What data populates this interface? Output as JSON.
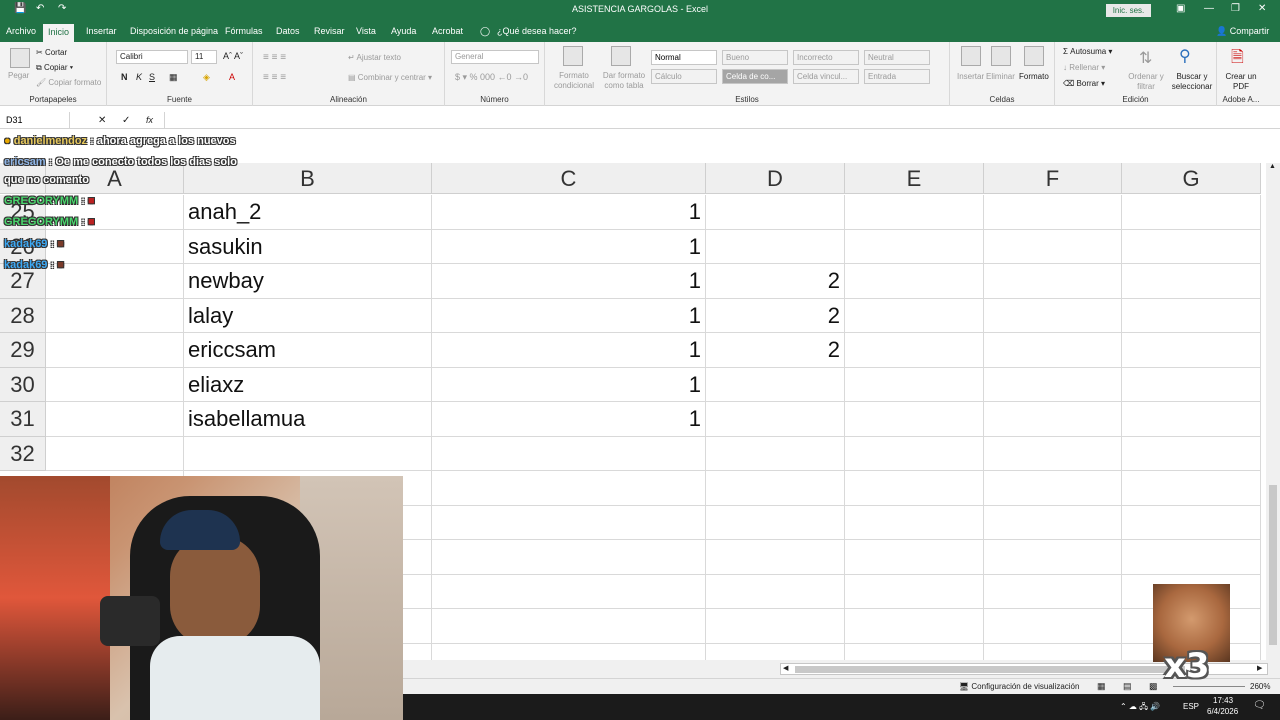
{
  "window": {
    "title": "ASISTENCIA GARGOLAS  -  Excel",
    "signin": "Inic. ses."
  },
  "tabs": [
    "Archivo",
    "Inicio",
    "Insertar",
    "Disposición de página",
    "Fórmulas",
    "Datos",
    "Revisar",
    "Vista",
    "Ayuda",
    "Acrobat"
  ],
  "tell_me": "¿Qué desea hacer?",
  "share": "Compartir",
  "ribbon": {
    "clipboard": {
      "paste": "Pegar",
      "cut": "Cortar",
      "copy": "Copiar",
      "format_painter": "Copiar formato",
      "label": "Portapapeles"
    },
    "font": {
      "name": "Calibri",
      "size": "11",
      "label": "Fuente"
    },
    "alignment": {
      "wrap": "Ajustar texto",
      "merge": "Combinar y centrar",
      "label": "Alineación"
    },
    "number": {
      "format": "General",
      "label": "Número"
    },
    "styles": {
      "conditional": "Formato condicional",
      "as_table": "Dar formato como tabla",
      "cells": [
        "Normal",
        "Bueno",
        "Incorrecto",
        "Neutral",
        "Cálculo",
        "Celda de co...",
        "Celda vincul...",
        "Entrada"
      ],
      "label": "Estilos"
    },
    "cells_group": {
      "insert": "Insertar",
      "delete": "Eliminar",
      "format": "Formato",
      "label": "Celdas"
    },
    "editing": {
      "autosum": "Autosuma",
      "fill": "Rellenar",
      "clear": "Borrar",
      "sort": "Ordenar y filtrar",
      "find": "Buscar y seleccionar",
      "label": "Edición"
    },
    "adobe": {
      "create_pdf": "Crear un PDF",
      "label": "Adobe A..."
    }
  },
  "formula_bar": {
    "name_box": "D31",
    "fx": "fx"
  },
  "sheet": {
    "columns": [
      "A",
      "B",
      "C",
      "D",
      "E",
      "F",
      "G"
    ],
    "rows": [
      {
        "n": "25",
        "b": "anah_2",
        "c": "1",
        "d": ""
      },
      {
        "n": "26",
        "b": "sasukin",
        "c": "1",
        "d": ""
      },
      {
        "n": "27",
        "b": "newbay",
        "c": "1",
        "d": "2"
      },
      {
        "n": "28",
        "b": "lalay",
        "c": "1",
        "d": "2"
      },
      {
        "n": "29",
        "b": "ericcsam",
        "c": "1",
        "d": "2"
      },
      {
        "n": "30",
        "b": "eliaxz",
        "c": "1",
        "d": ""
      },
      {
        "n": "31",
        "b": "isabellamua",
        "c": "1",
        "d": ""
      },
      {
        "n": "32",
        "b": "",
        "c": "",
        "d": ""
      }
    ]
  },
  "status": {
    "display_settings": "Configuración de visualización",
    "zoom": "260%"
  },
  "taskbar": {
    "lang": "ESP",
    "time": "17:43",
    "date": "6/4/2026"
  },
  "chat": [
    {
      "user": "danielmendoz",
      "text": ": ahora agrega a los nuevos"
    },
    {
      "user": "ericsam",
      "text": ": Oe me conecto todos los dias solo"
    },
    {
      "user": "",
      "text": "que no comento"
    },
    {
      "user": "GREGORYMM",
      "text": ":"
    },
    {
      "user": "GREGORYMM",
      "text": ":"
    },
    {
      "user": "kadak69",
      "text": ":"
    },
    {
      "user": "kadak69",
      "text": ":"
    }
  ],
  "overlay": {
    "emote_multiplier": "x3"
  }
}
